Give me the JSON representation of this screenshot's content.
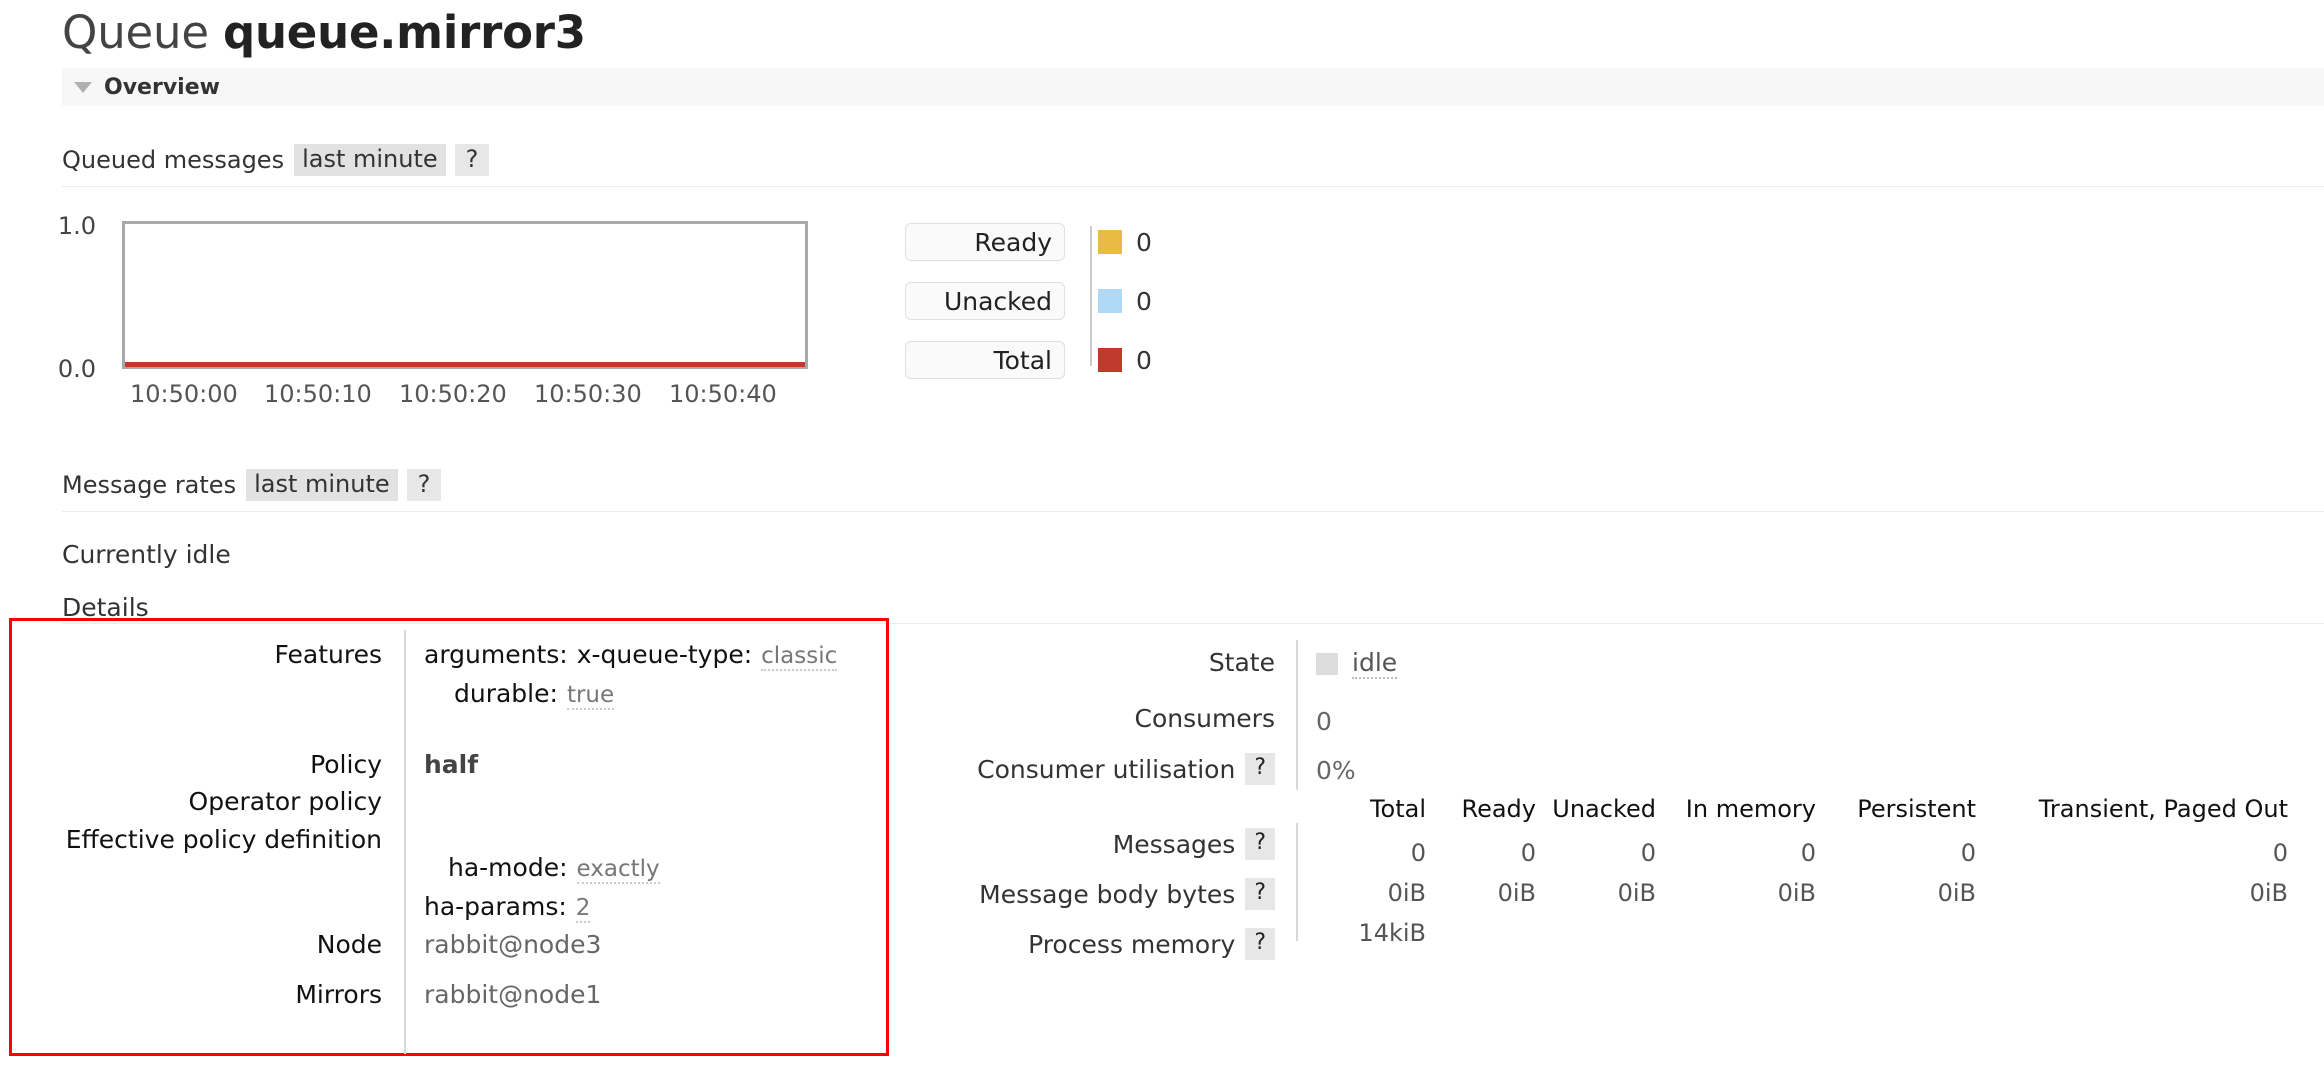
{
  "header": {
    "title_prefix": "Queue",
    "queue_name": "queue.mirror3",
    "section_label": "Overview",
    "caret_icon": "caret-down-icon"
  },
  "queued_messages": {
    "label": "Queued messages",
    "period_chip": "last minute",
    "help_chip": "?"
  },
  "message_rates": {
    "label": "Message rates",
    "period_chip": "last minute",
    "help_chip": "?",
    "idle_text": "Currently idle"
  },
  "details_label": "Details",
  "chart_data": {
    "type": "line",
    "title": "Queued messages",
    "xlabel": "",
    "ylabel": "",
    "ylim": [
      0.0,
      1.0
    ],
    "yticks": [
      "1.0",
      "0.0"
    ],
    "xticks": [
      "10:50:00",
      "10:50:10",
      "10:50:20",
      "10:50:30",
      "10:50:40"
    ],
    "grid": false,
    "legend_position": "right",
    "series": [
      {
        "name": "Ready",
        "color": "#e8bb43",
        "value": "0",
        "values": [
          0,
          0,
          0,
          0,
          0
        ]
      },
      {
        "name": "Unacked",
        "color": "#aed8f4",
        "value": "0",
        "values": [
          0,
          0,
          0,
          0,
          0
        ]
      },
      {
        "name": "Total",
        "color": "#c0392b",
        "value": "0",
        "values": [
          0,
          0,
          0,
          0,
          0
        ]
      }
    ]
  },
  "details_left": {
    "rows": [
      {
        "key": "Features",
        "type": "args"
      },
      {
        "key": "Policy",
        "type": "bold",
        "value": "half"
      },
      {
        "key": "Operator policy",
        "type": "empty",
        "value": ""
      },
      {
        "key": "Effective policy definition",
        "type": "args2"
      },
      {
        "key": "Node",
        "type": "plain",
        "value": "rabbit@node3"
      },
      {
        "key": "Mirrors",
        "type": "plain",
        "value": "rabbit@node1"
      }
    ],
    "features": [
      {
        "name": "arguments:",
        "sub": "x-queue-type:",
        "value": "classic"
      },
      {
        "name": "durable:",
        "sub": "",
        "value": "true"
      }
    ],
    "effective_policy": [
      {
        "name": "ha-mode:",
        "value": "exactly"
      },
      {
        "name": "ha-params:",
        "value": "2"
      }
    ]
  },
  "details_right": {
    "state_label": "State",
    "state_value": "idle",
    "consumers_label": "Consumers",
    "consumers_value": "0",
    "consumer_utilisation_label": "Consumer utilisation",
    "consumer_utilisation_help": "?",
    "consumer_utilisation_value": "0%",
    "columns": [
      "Total",
      "Ready",
      "Unacked",
      "In memory",
      "Persistent",
      "Transient, Paged Out"
    ],
    "rows": [
      {
        "label": "Messages",
        "help": "?",
        "values": [
          "0",
          "0",
          "0",
          "0",
          "0",
          "0"
        ]
      },
      {
        "label": "Message body bytes",
        "help": "?",
        "values": [
          "0iB",
          "0iB",
          "0iB",
          "0iB",
          "0iB",
          "0iB"
        ]
      },
      {
        "label": "Process memory",
        "help": "?",
        "values": [
          "14kiB",
          "",
          "",
          "",
          "",
          ""
        ]
      }
    ]
  },
  "colors": {
    "ready": "#e8bb43",
    "unacked": "#aed8f4",
    "total": "#c0392b",
    "highlight_box": "#ff0000"
  }
}
